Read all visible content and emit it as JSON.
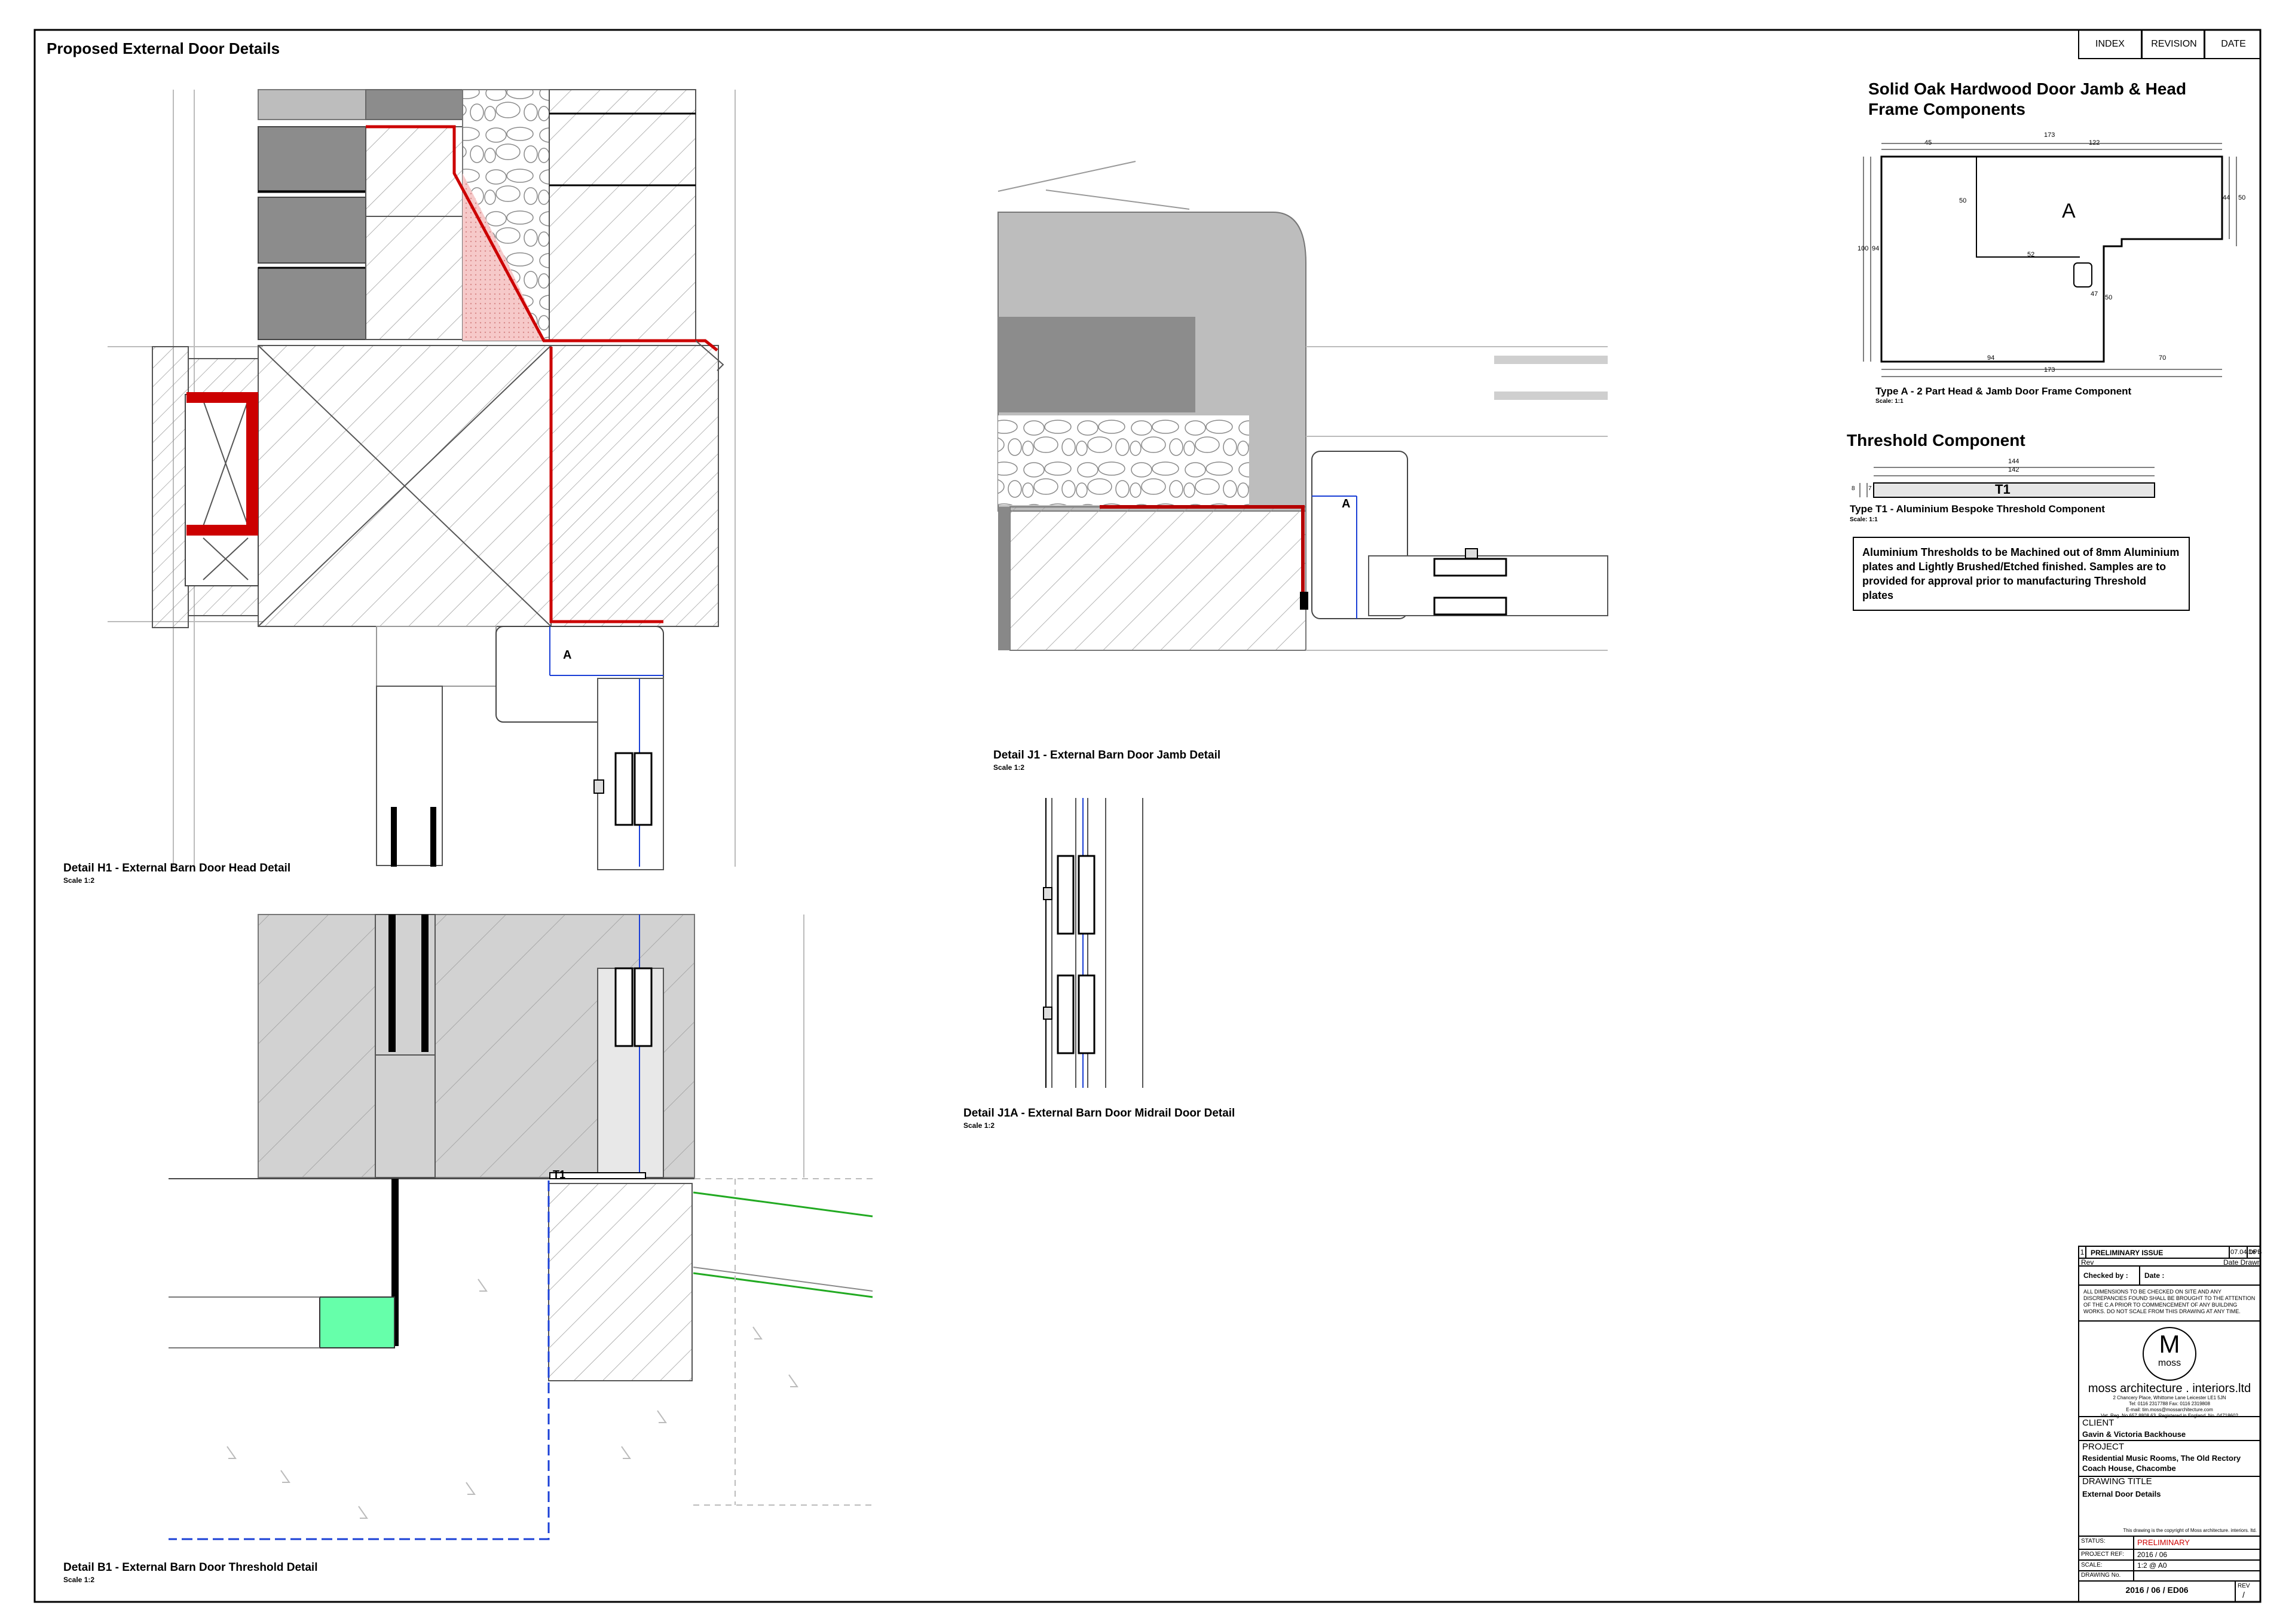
{
  "sheet": {
    "title": "Proposed External Door Details",
    "header_cells": [
      "INDEX",
      "REVISION",
      "DATE"
    ]
  },
  "details": {
    "h1": {
      "caption": "Detail H1 - External Barn Door Head Detail",
      "scale": "Scale 1:2",
      "marker": "A"
    },
    "j1": {
      "caption": "Detail J1 - External Barn Door Jamb Detail",
      "scale": "Scale 1:2",
      "marker": "A"
    },
    "j1a": {
      "caption": "Detail J1A - External Barn Door Midrail Door Detail",
      "scale": "Scale 1:2"
    },
    "b1": {
      "caption": "Detail B1 - External Barn Door Threshold Detail",
      "scale": "Scale 1:2",
      "marker": "T1"
    }
  },
  "components": {
    "frame": {
      "heading": "Solid Oak Hardwood Door Jamb & Head Frame Components",
      "letter": "A",
      "caption": "Type A - 2 Part Head & Jamb Door Frame Component",
      "scale": "Scale: 1:1",
      "dims": {
        "top_total": "173",
        "top_left": "45",
        "top_right": "122",
        "inner_v": "50",
        "right_a": "44",
        "right_b": "50",
        "left_a": "100",
        "left_b": "94",
        "mid_h": "52",
        "rebate_a": "47",
        "rebate_b": "50",
        "bot_left": "94",
        "bot_right": "70",
        "bot_total": "173"
      }
    },
    "threshold": {
      "heading": "Threshold Component",
      "letter": "T1",
      "caption": "Type T1 - Aluminium Bespoke Threshold Component",
      "scale": "Scale: 1:1",
      "dims": {
        "outer": "144",
        "inner": "142",
        "h1": "8",
        "h2": "7"
      },
      "note": "Aluminium Thresholds to be Machined out of 8mm Aluminium plates and Lightly Brushed/Etched finished. Samples are to provided for approval prior to manufacturing Threshold plates"
    }
  },
  "title_block": {
    "revision": {
      "rev": "1",
      "text": "PRELIMINARY ISSUE",
      "date": "07.04.16",
      "drawn": "DPB"
    },
    "rev_header": {
      "rev": "Rev",
      "date_drawn": "Date  Drawn"
    },
    "checked_by": "Checked by :",
    "date": "Date :",
    "disclaimer": "ALL DIMENSIONS TO BE CHECKED ON SITE AND ANY DISCREPANCIES FOUND SHALL BE BROUGHT TO THE ATTENTION OF THE C.A PRIOR TO COMMENCEMENT OF ANY BUILDING WORKS. DO NOT SCALE FROM THIS DRAWING AT ANY TIME.",
    "logo_letter": "M",
    "logo_word": "moss",
    "company": "moss architecture . interiors.ltd",
    "address": [
      "2 Chancery Place, Whittome Lane Leicester LE1 5JN",
      "Tel: 0116 2317788  Fax: 0116 2319808",
      "E-mail: tim.moss@mossarchitecture.com",
      "Vat. Reg. No 657 8808 63. Registered in England. No. 04718602"
    ],
    "client_label": "CLIENT",
    "client": "Gavin & Victoria Backhouse",
    "project_label": "PROJECT",
    "project_line1": "Residential Music Rooms, The Old Rectory",
    "project_line2": "Coach House, Chacombe",
    "drawing_title_label": "DRAWING TITLE",
    "drawing_title": "External Door Details",
    "copyright": "This drawing is the copyright of Moss architecture. interiors. ltd.",
    "status_label": "STATUS:",
    "status": "PRELIMINARY",
    "project_ref_label": "PROJECT REF:",
    "project_ref": "2016 / 06",
    "scale_label": "SCALE:",
    "scale": "1:2 @ A0",
    "drawing_no_label": "DRAWING No.",
    "drawing_no": "2016 / 06 / ED06",
    "rev_label": "REV",
    "rev_value": "/"
  },
  "colors": {
    "red": "#cc0000",
    "blue": "#1a3fd6",
    "green": "#22aa22",
    "insulation": "#66ffaa",
    "dark_grey": "#888888",
    "mid_grey": "#bdbdbd",
    "light_grey": "#d9d9d9",
    "pink": "#f6c9c9"
  }
}
